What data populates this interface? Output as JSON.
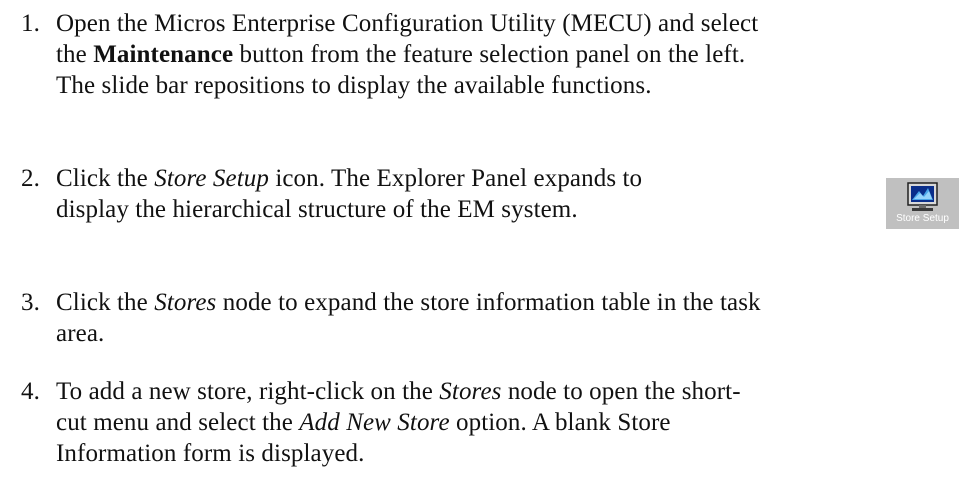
{
  "steps": [
    {
      "number": "1.",
      "lines": [
        [
          "Open the Micros Enterprise Configuration Utility (MECU) and select"
        ],
        [
          "the ",
          "Maintenance",
          " button from the feature selection panel on the left."
        ],
        [
          "The slide bar repositions to display the available functions."
        ]
      ]
    },
    {
      "number": "2.",
      "lines": [
        [
          "Click the ",
          "Store Setup",
          " icon.  The Explorer Panel expands to"
        ],
        [
          "display the hierarchical structure of the EM system."
        ]
      ]
    },
    {
      "number": "3.",
      "lines": [
        [
          "Click the ",
          "Stores",
          " node to expand the store information table in the task"
        ],
        [
          "area."
        ]
      ]
    },
    {
      "number": "4.",
      "lines": [
        [
          "To add a new store, right-click on the ",
          "Stores",
          " node to open the short-"
        ],
        [
          "cut menu and select the ",
          "Add New Store",
          " option. A blank Store"
        ],
        [
          "Information form is displayed."
        ]
      ]
    }
  ],
  "store_icon": {
    "label": "Store Setup",
    "icon": "computer-monitor-icon",
    "background": "#c0c0c0"
  }
}
